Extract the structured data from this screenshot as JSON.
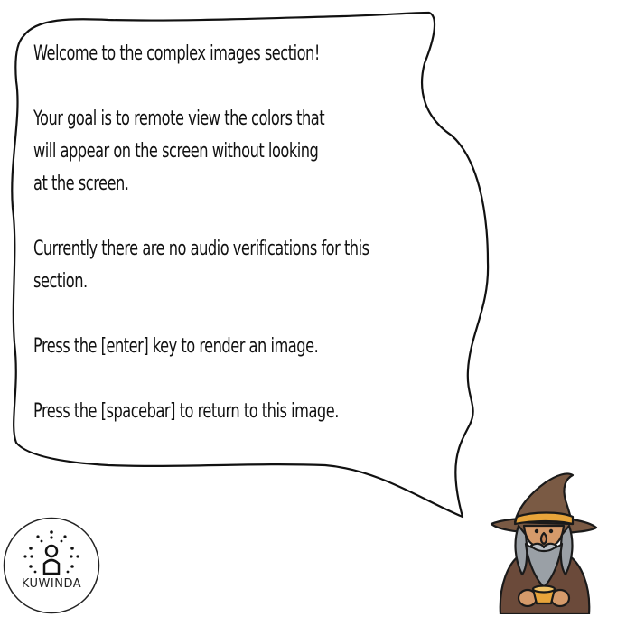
{
  "dialog": {
    "lines": [
      "Welcome to the complex images section!",
      "Your goal is to remote view the colors that\nwill appear on the screen without looking\nat the screen.",
      "Currently there are no audio verifications for this\nsection.",
      "Press the [enter] key to render an image.",
      "Press the [spacebar] to return to this image."
    ]
  },
  "logo": {
    "label": "KUWINDA"
  },
  "character": {
    "name": "wizard",
    "hat_color": "#7a5a44",
    "hat_band_color": "#e7a43a",
    "robe_color": "#6b4a3a",
    "beard_color": "#9aa0a6"
  },
  "colors": {
    "background": "#ffffff",
    "outline": "#111111"
  }
}
